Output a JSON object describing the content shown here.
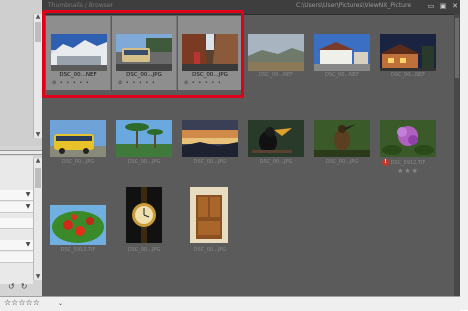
{
  "window": {
    "toolbar_left_text": "Thumbnails / Browser",
    "path": "C:\\Users\\User\\Pictures\\ViewNX_Picture",
    "icons": [
      "window-restore-icon",
      "window-maximize-icon",
      "window-close-icon"
    ]
  },
  "bottom": {
    "rating_filter": "☆☆☆☆☆",
    "dropdown_glyph": "⌄"
  },
  "thumbnails": [
    {
      "caption": "DSC_00...NEF",
      "selected": true,
      "meta": "⊘ • • • • •"
    },
    {
      "caption": "DSC_00...JPG",
      "selected": true,
      "meta": "⊘ • • • • •"
    },
    {
      "caption": "DSC_00...JPG",
      "selected": true,
      "meta": "⊘ • • • • •"
    },
    {
      "caption": "DSC_00...NEF",
      "selected": false
    },
    {
      "caption": "DSC_00...NEF",
      "selected": false
    },
    {
      "caption": "DSC_00...NEF",
      "selected": false
    },
    {
      "caption": "DSC_00...JPG",
      "selected": false
    },
    {
      "caption": "DSC_00...JPG",
      "selected": false
    },
    {
      "caption": "DSC_00...JPG",
      "selected": false
    },
    {
      "caption": "DSC_00...JPG",
      "selected": false
    },
    {
      "caption": "DSC_00...JPG",
      "selected": false
    },
    {
      "caption": "DSC_5912.TIF",
      "selected": false,
      "rating": "★★★",
      "alert": "!"
    },
    {
      "caption": "DSC_5913.TIF",
      "selected": false
    },
    {
      "caption": "DSC_00...JPG",
      "selected": false
    },
    {
      "caption": "DSC_00...JPG",
      "selected": false
    }
  ]
}
